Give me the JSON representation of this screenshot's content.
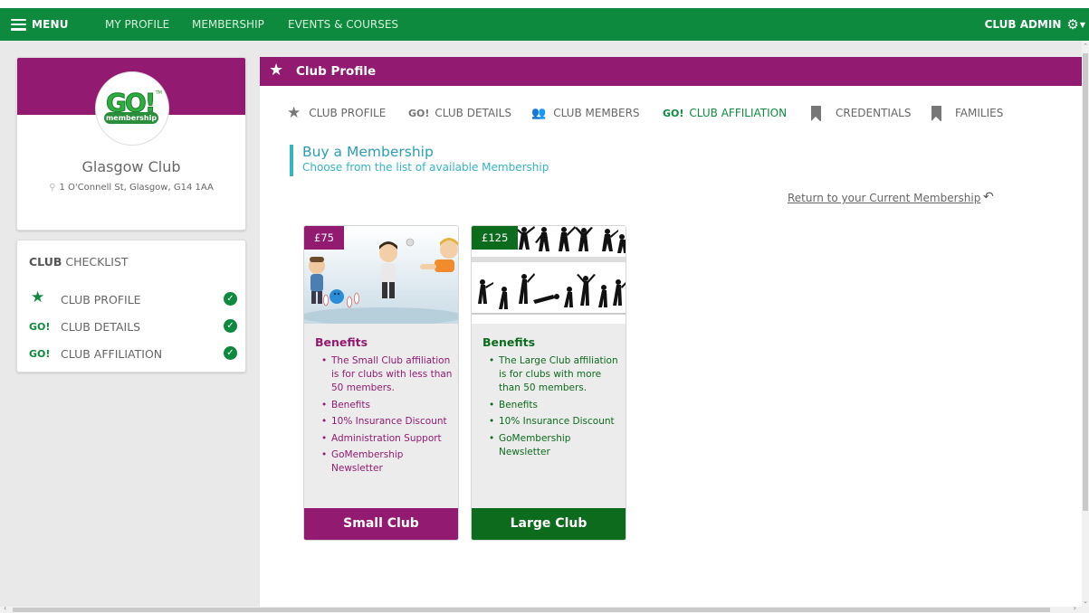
{
  "nav": {
    "menu_label": "MENU",
    "items": [
      {
        "label": "MY PROFILE"
      },
      {
        "label": "MEMBERSHIP"
      },
      {
        "label": "EVENTS & COURSES"
      }
    ],
    "admin_label": "CLUB ADMIN"
  },
  "profile": {
    "logo_text": "GO!",
    "logo_sub": "membership",
    "logo_tm": "TM",
    "club_name": "Glasgow Club",
    "address": "1 O'Connell St, Glasgow, G14 1AA"
  },
  "checklist": {
    "title_bold": "CLUB",
    "title_rest": " CHECKLIST",
    "items": [
      {
        "icon": "star-icon",
        "icon_text": "★",
        "label": "CLUB PROFILE"
      },
      {
        "icon": "go-icon",
        "icon_text": "GO!",
        "label": "CLUB DETAILS"
      },
      {
        "icon": "go-icon",
        "icon_text": "GO!",
        "label": "CLUB AFFILIATION"
      }
    ],
    "check_glyph": "✓"
  },
  "main": {
    "header_title": "Club Profile",
    "tabs": [
      {
        "label": "CLUB PROFILE",
        "icon": "star-icon",
        "icon_text": "★"
      },
      {
        "label": "CLUB DETAILS",
        "icon": "go-icon",
        "icon_text": "GO!"
      },
      {
        "label": "CLUB MEMBERS",
        "icon": "people-icon",
        "icon_text": "👥"
      },
      {
        "label": "CLUB AFFILIATION",
        "icon": "go-icon",
        "icon_text": "GO!",
        "active": true
      },
      {
        "label": "CREDENTIALS",
        "icon": "bookmark-icon"
      },
      {
        "label": "FAMILIES",
        "icon": "bookmark-icon"
      }
    ],
    "section_title": "Buy a Membership",
    "section_subtitle": "Choose from the list of available Membership",
    "return_link": "Return to your Current Membership"
  },
  "memberships": [
    {
      "price": "£75",
      "benefits_title": "Benefits",
      "benefits": [
        "The Small Club affiliation is for clubs with less than 50 members.",
        "Benefits",
        "10% Insurance Discount",
        "Administration Support",
        "GoMembership Newsletter"
      ],
      "cta": "Small Club"
    },
    {
      "price": "£125",
      "benefits_title": "Benefits",
      "benefits": [
        "The Large Club affiliation is for clubs with more than 50 members.",
        "Benefits",
        "10% Insurance Discount",
        "GoMembership Newsletter"
      ],
      "cta": "Large Club"
    }
  ],
  "colors": {
    "nav_green": "#0d8a3e",
    "brand_purple": "#921b71",
    "dark_green": "#0d6b1e",
    "teal": "#35b4c3"
  }
}
